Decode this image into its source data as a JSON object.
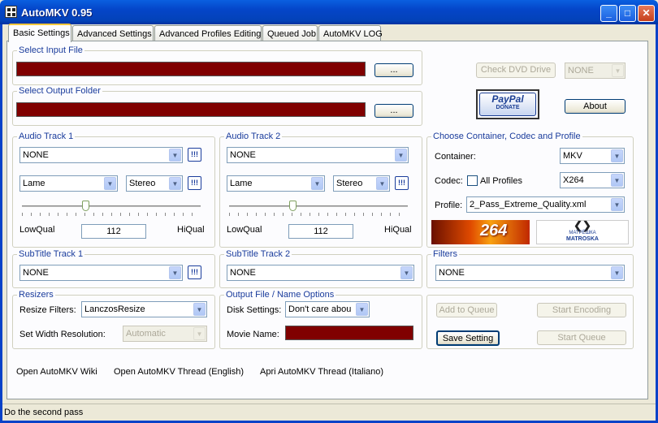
{
  "window": {
    "title": "AutoMKV 0.95",
    "minimize": "_",
    "maximize": "□",
    "close": "✕"
  },
  "tabs": [
    "Basic Settings",
    "Advanced Settings",
    "Advanced Profiles Editing",
    "Queued Job",
    "AutoMKV LOG"
  ],
  "input": {
    "label": "Select Input File",
    "browse": "...",
    "folder_label": "Select Output Folder"
  },
  "dvd": {
    "button": "Check DVD Drive",
    "value": "NONE"
  },
  "paypal": {
    "brand": "PayPal",
    "sub": "DONATE"
  },
  "about": "About",
  "audio1": {
    "label": "Audio Track 1",
    "track": "NONE",
    "codec": "Lame",
    "channels": "Stereo",
    "low": "LowQual",
    "high": "HiQual",
    "bitrate": "112",
    "bang": "!!!"
  },
  "audio2": {
    "label": "Audio Track 2",
    "track": "NONE",
    "codec": "Lame",
    "channels": "Stereo",
    "low": "LowQual",
    "high": "HiQual",
    "bitrate": "112",
    "bang": "!!!"
  },
  "container": {
    "label": "Choose Container, Codec and Profile",
    "container_label": "Container:",
    "container_value": "MKV",
    "codec_label": "Codec:",
    "all_profiles": "All Profiles",
    "codec_value": "X264",
    "profile_label": "Profile:",
    "profile_value": "2_Pass_Extreme_Quality.xml",
    "logo1": "264",
    "logo2_a": "МАТРЁШКА",
    "logo2_b": "MATROSKA"
  },
  "sub1": {
    "label": "SubTitle Track 1",
    "value": "NONE",
    "bang": "!!!"
  },
  "sub2": {
    "label": "SubTitle Track 2",
    "value": "NONE"
  },
  "filters": {
    "label": "Filters",
    "value": "NONE"
  },
  "resizers": {
    "label": "Resizers",
    "filter_label": "Resize Filters:",
    "filter_value": "LanczosResize",
    "width_label": "Set Width Resolution:",
    "width_value": "Automatic"
  },
  "output": {
    "label": "Output File / Name Options",
    "disk_label": "Disk Settings:",
    "disk_value": "Don't care abou",
    "movie_label": "Movie Name:"
  },
  "actions": {
    "add_queue": "Add to Queue",
    "start_encoding": "Start Encoding",
    "save_setting": "Save Setting",
    "start_queue": "Start Queue"
  },
  "links": [
    "Open AutoMKV Wiki",
    "Open AutoMKV Thread (English)",
    "Apri AutoMKV Thread (Italiano)"
  ],
  "status": "Do the second pass",
  "colors": {
    "accent": "#1a3c9c",
    "field_red": "#800000",
    "titlebar": "#0445c8"
  }
}
